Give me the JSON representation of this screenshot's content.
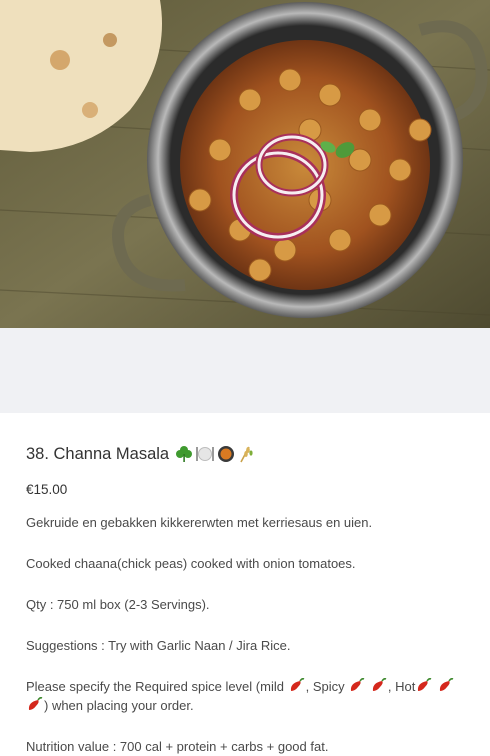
{
  "image": {
    "alt": "Channa Masala in a copper pot with naan"
  },
  "product": {
    "title": "38. Channa Masala",
    "title_icons": [
      "shamrock-icon",
      "plate-cutlery-icon",
      "curry-bowl-icon",
      "wheat-icon"
    ],
    "price": "€15.00",
    "desc_nl": "Gekruide en gebakken kikkererwten met kerriesaus en uien.",
    "desc_en": "Cooked chaana(chick peas) cooked with onion tomatoes.",
    "qty": "Qty : 750 ml box (2-3 Servings).",
    "suggestions": "Suggestions : Try with Garlic Naan / Jira Rice.",
    "spice_prefix": "Please specify the Required spice level (mild",
    "spice_spicy": ", Spicy",
    "spice_hot": ", Hot",
    "spice_suffix": ") when placing your order.",
    "nutrition": "Nutrition value : 700 cal + protein + carbs + good fat."
  },
  "colors": {
    "wood": "#6f6a45",
    "chili": "#d4281c",
    "gap_bg": "#f0f1f4"
  }
}
